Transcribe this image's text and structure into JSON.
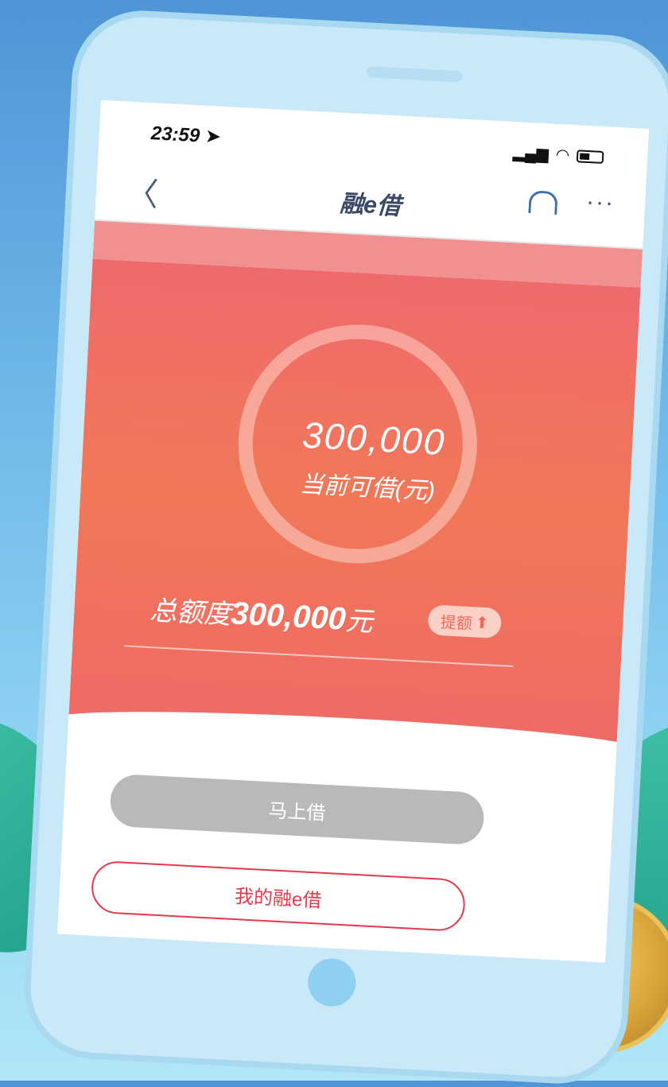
{
  "status_bar": {
    "time": "23:59",
    "signal": "▂▄▆",
    "wifi": "◠"
  },
  "nav": {
    "back_symbol": "〈",
    "title": "融e借",
    "more_symbol": "···"
  },
  "card": {
    "available_amount": "300,000",
    "available_label": "当前可借(元)",
    "total_prefix": "总额度",
    "total_amount": "300,000",
    "total_suffix": "元",
    "raise_label": "提额",
    "raise_icon": "⬆"
  },
  "actions": {
    "borrow_now_label": "马上借",
    "my_loan_label": "我的融e借"
  },
  "colors": {
    "card_top": "#ef6a6b",
    "accent_red": "#e33b4a",
    "disabled_gray": "#b9b9bb"
  },
  "icons": [
    "back-icon",
    "headset-icon",
    "more-icon",
    "location-arrow-icon",
    "signal-icon",
    "wifi-icon",
    "battery-icon",
    "arrow-up-icon"
  ]
}
